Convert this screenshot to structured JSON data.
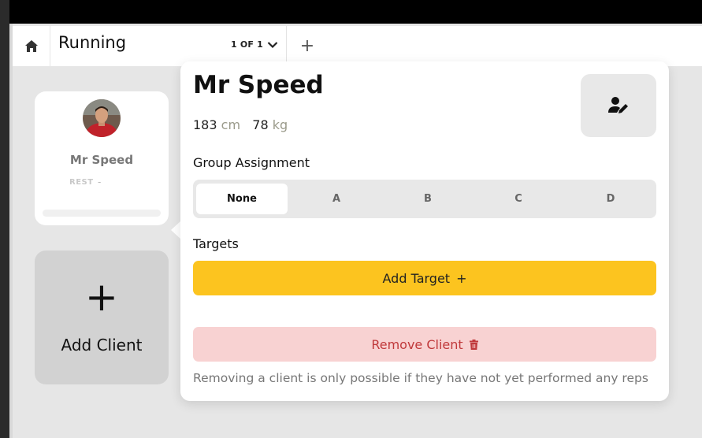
{
  "tab": {
    "title": "Running",
    "count": "1 OF 1",
    "icons": {
      "home": "home-icon",
      "dropdown": "chevron-down-icon",
      "add": "plus-icon"
    },
    "add_symbol": "+"
  },
  "client_card": {
    "name": "Mr Speed",
    "status": "REST",
    "status_dash": "-"
  },
  "add_client": {
    "symbol": "+",
    "label": "Add Client"
  },
  "popup": {
    "name": "Mr Speed",
    "height_value": "183",
    "height_unit": "cm",
    "weight_value": "78",
    "weight_unit": "kg",
    "group_label": "Group Assignment",
    "groups": [
      "None",
      "A",
      "B",
      "C",
      "D"
    ],
    "selected_group": "None",
    "targets_label": "Targets",
    "add_target_label": "Add Target",
    "add_target_symbol": "+",
    "remove_label": "Remove Client",
    "remove_note": "Removing a client is only possible if they have not yet performed any reps"
  },
  "colors": {
    "accent": "#fcc41f",
    "danger_bg": "#f8d2d2",
    "danger_text": "#c0393b"
  }
}
